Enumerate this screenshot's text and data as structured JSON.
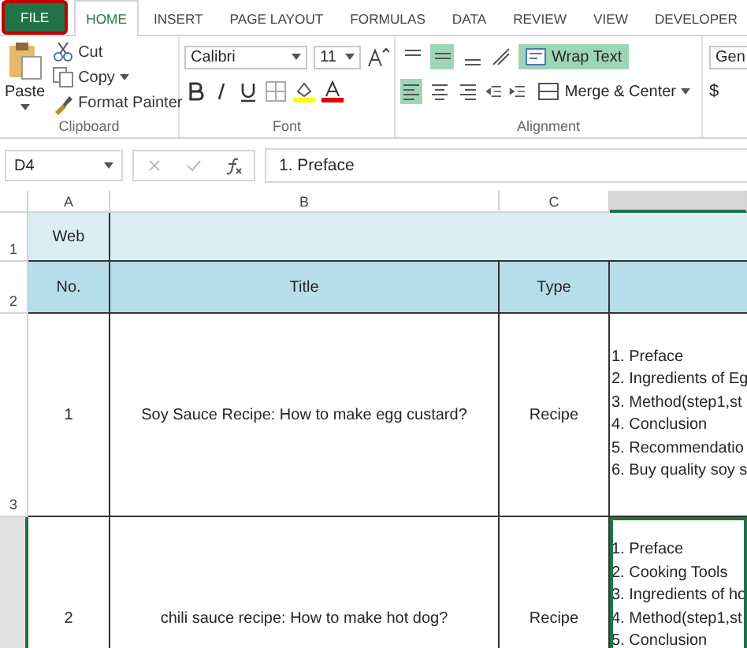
{
  "tabs": [
    {
      "label": "FILE",
      "kind": "file",
      "selected": false
    },
    {
      "label": "HOME",
      "kind": "tab",
      "selected": true
    },
    {
      "label": "INSERT",
      "kind": "tab",
      "selected": false
    },
    {
      "label": "PAGE LAYOUT",
      "kind": "tab",
      "selected": false
    },
    {
      "label": "FORMULAS",
      "kind": "tab",
      "selected": false
    },
    {
      "label": "DATA",
      "kind": "tab",
      "selected": false
    },
    {
      "label": "REVIEW",
      "kind": "tab",
      "selected": false
    },
    {
      "label": "VIEW",
      "kind": "tab",
      "selected": false
    },
    {
      "label": "DEVELOPER",
      "kind": "tab",
      "selected": false
    }
  ],
  "ribbon": {
    "clipboard": {
      "label": "Clipboard",
      "paste": "Paste",
      "cut": "Cut",
      "copy": "Copy",
      "format_painter": "Format Painter"
    },
    "font": {
      "label": "Font",
      "family": "Calibri",
      "size": "11"
    },
    "alignment": {
      "label": "Alignment",
      "vertical": [
        {
          "selected": false
        },
        {
          "selected": true
        },
        {
          "selected": false
        }
      ],
      "horizontal": [
        {
          "selected": true
        },
        {
          "selected": false
        },
        {
          "selected": false
        }
      ],
      "wrap_text": {
        "label": "Wrap Text",
        "on": true
      },
      "merge": "Merge & Center"
    },
    "number": {
      "format": "Gen",
      "currency": "$"
    }
  },
  "formula_bar": {
    "name_box": "D4",
    "formula": "1. Preface"
  },
  "sheet": {
    "columns": [
      {
        "label": "A",
        "selected": false
      },
      {
        "label": "B",
        "selected": false
      },
      {
        "label": "C",
        "selected": false
      },
      {
        "selected": true
      }
    ],
    "rows": [
      {
        "number": "1",
        "kind": "banner",
        "selected": false,
        "cells": [
          "Web"
        ]
      },
      {
        "number": "2",
        "kind": "header",
        "selected": false,
        "cells": [
          "No.",
          "Title",
          "Type"
        ]
      },
      {
        "number": "3",
        "kind": "entry",
        "selected": false,
        "cells": [
          "1",
          "Soy Sauce Recipe: How to make egg custard?",
          "Recipe"
        ],
        "outline": [
          "1. Preface",
          "2. Ingredients of Eg",
          "3. Method(step1,st",
          "4. Conclusion",
          "5. Recommendatio",
          "6. Buy quality soy s"
        ]
      },
      {
        "kind": "entry",
        "selected": true,
        "cells": [
          "2",
          "chili sauce recipe: How to make hot dog?",
          "Recipe"
        ],
        "outline": [
          "1. Preface",
          "2. Cooking Tools",
          "3. Ingredients of ho",
          "4. Method(step1,st",
          "5. Conclusion"
        ]
      }
    ]
  }
}
